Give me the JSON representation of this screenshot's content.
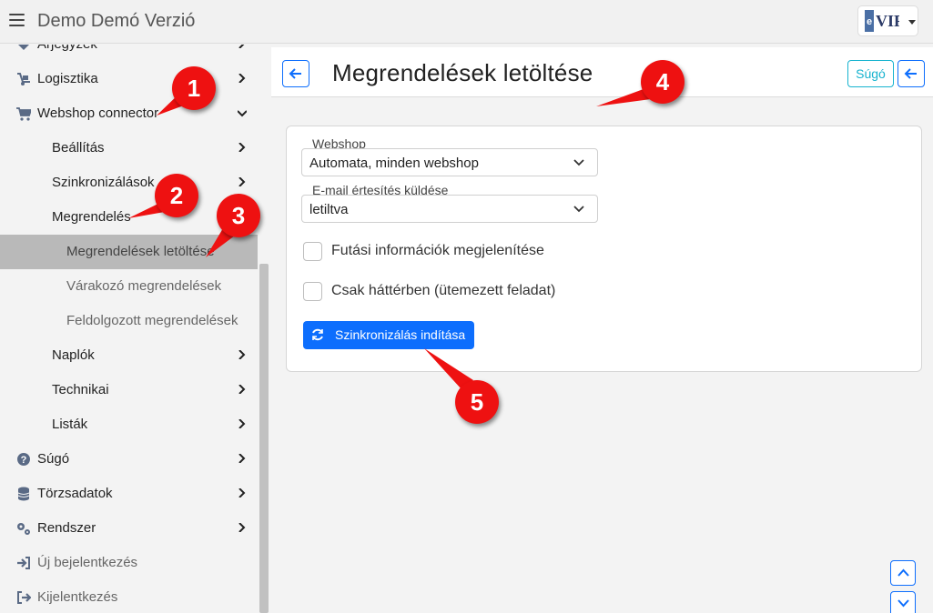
{
  "app": {
    "title": "Demo Demó Verzió",
    "logo_text": "e VIR"
  },
  "sidebar": {
    "items": [
      {
        "label": "Árjegyzék",
        "icon": "tag-icon"
      },
      {
        "label": "Logisztika",
        "icon": "dolly-icon"
      },
      {
        "label": "Webshop connector",
        "icon": "cart-icon"
      },
      {
        "label": "Beállítás"
      },
      {
        "label": "Szinkronizálások"
      },
      {
        "label": "Megrendelés"
      },
      {
        "label": "Megrendelések letöltése"
      },
      {
        "label": "Várakozó megrendelések"
      },
      {
        "label": "Feldolgozott megrendelések"
      },
      {
        "label": "Naplók"
      },
      {
        "label": "Technikai"
      },
      {
        "label": "Listák"
      },
      {
        "label": "Súgó",
        "icon": "question-circle-icon"
      },
      {
        "label": "Törzsadatok",
        "icon": "database-icon"
      },
      {
        "label": "Rendszer",
        "icon": "cogs-icon"
      },
      {
        "label": "Új bejelentkezés",
        "icon": "sign-in-icon"
      },
      {
        "label": "Kijelentkezés",
        "icon": "sign-out-icon"
      }
    ]
  },
  "main": {
    "title": "Megrendelések letöltése",
    "help_label": "Súgó",
    "form": {
      "webshop_label": "Webshop",
      "webshop_value": "Automata, minden webshop",
      "email_label": "E-mail értesítés küldése",
      "email_value": "letiltva",
      "check_info_label": "Futási információk megjelenítése",
      "check_background_label": "Csak háttérben (ütemezett feladat)",
      "sync_button_label": "Szinkronizálás indítása"
    }
  },
  "markers": [
    "1",
    "2",
    "3",
    "4",
    "5"
  ],
  "colors": {
    "primary": "#0d6efd",
    "help": "#17b3cf",
    "marker": "#e11111",
    "active_bg": "#b9b9b9"
  }
}
